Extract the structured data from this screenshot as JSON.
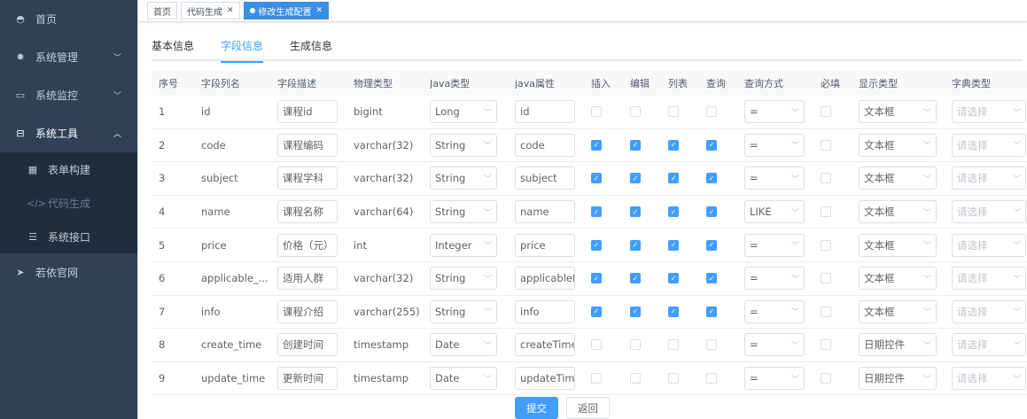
{
  "sidebar": {
    "items": [
      {
        "label": "首页",
        "icon": "dashboard-icon"
      },
      {
        "label": "系统管理",
        "icon": "gear-icon"
      },
      {
        "label": "系统监控",
        "icon": "monitor-icon"
      },
      {
        "label": "系统工具",
        "icon": "toolbox-icon"
      }
    ],
    "sub": [
      {
        "label": "表单构建"
      },
      {
        "label": "代码生成"
      },
      {
        "label": "系统接口"
      }
    ],
    "extra": {
      "label": "若依官网"
    }
  },
  "tags": [
    "首页",
    "代码生成",
    "修改生成配置"
  ],
  "tabs": [
    "基本信息",
    "字段信息",
    "生成信息"
  ],
  "columns": [
    "序号",
    "字段列名",
    "字段描述",
    "物理类型",
    "Java类型",
    "java属性",
    "插入",
    "编辑",
    "列表",
    "查询",
    "查询方式",
    "必填",
    "显示类型",
    "字典类型"
  ],
  "dict_placeholder": "请选择",
  "rows": [
    {
      "no": "1",
      "name": "id",
      "desc": "课程id",
      "type": "bigint",
      "java": "Long",
      "prop": "id",
      "ins": false,
      "edit": false,
      "list": false,
      "query": false,
      "qtype": "=",
      "req": false,
      "html": "文本框"
    },
    {
      "no": "2",
      "name": "code",
      "desc": "课程编码",
      "type": "varchar(32)",
      "java": "String",
      "prop": "code",
      "ins": true,
      "edit": true,
      "list": true,
      "query": true,
      "qtype": "=",
      "req": false,
      "html": "文本框"
    },
    {
      "no": "3",
      "name": "subject",
      "desc": "课程学科",
      "type": "varchar(32)",
      "java": "String",
      "prop": "subject",
      "ins": true,
      "edit": true,
      "list": true,
      "query": true,
      "qtype": "=",
      "req": false,
      "html": "文本框"
    },
    {
      "no": "4",
      "name": "name",
      "desc": "课程名称",
      "type": "varchar(64)",
      "java": "String",
      "prop": "name",
      "ins": true,
      "edit": true,
      "list": true,
      "query": true,
      "qtype": "LIKE",
      "req": false,
      "html": "文本框"
    },
    {
      "no": "5",
      "name": "price",
      "desc": "价格（元）",
      "type": "int",
      "java": "Integer",
      "prop": "price",
      "ins": true,
      "edit": true,
      "list": true,
      "query": true,
      "qtype": "=",
      "req": false,
      "html": "文本框"
    },
    {
      "no": "6",
      "name": "applicable_...",
      "desc": "适用人群",
      "type": "varchar(32)",
      "java": "String",
      "prop": "applicablePerson",
      "ins": true,
      "edit": true,
      "list": true,
      "query": true,
      "qtype": "=",
      "req": false,
      "html": "文本框"
    },
    {
      "no": "7",
      "name": "info",
      "desc": "课程介绍",
      "type": "varchar(255)",
      "java": "String",
      "prop": "info",
      "ins": true,
      "edit": true,
      "list": true,
      "query": true,
      "qtype": "=",
      "req": false,
      "html": "文本框"
    },
    {
      "no": "8",
      "name": "create_time",
      "desc": "创建时间",
      "type": "timestamp",
      "java": "Date",
      "prop": "createTime",
      "ins": false,
      "edit": false,
      "list": false,
      "query": false,
      "qtype": "=",
      "req": false,
      "html": "日期控件"
    },
    {
      "no": "9",
      "name": "update_time",
      "desc": "更新时间",
      "type": "timestamp",
      "java": "Date",
      "prop": "updateTime",
      "ins": false,
      "edit": false,
      "list": false,
      "query": false,
      "qtype": "=",
      "req": false,
      "html": "日期控件"
    }
  ],
  "buttons": {
    "submit": "提交",
    "back": "返回"
  }
}
